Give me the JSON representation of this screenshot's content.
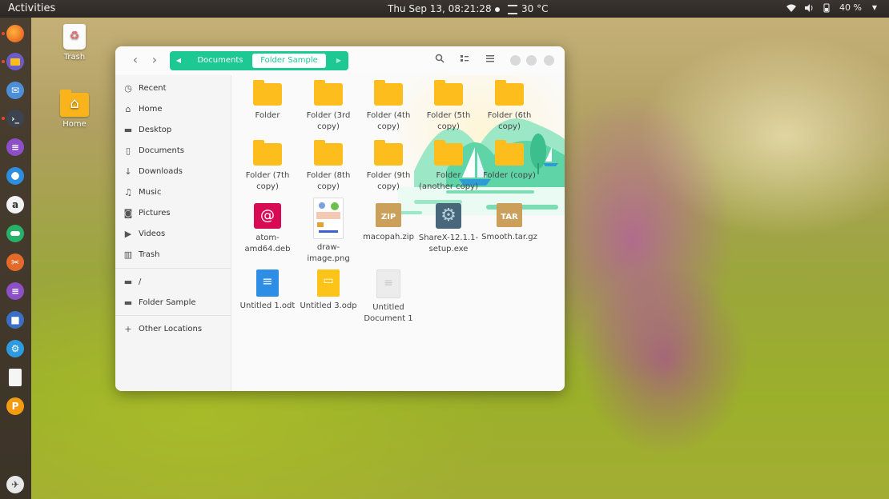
{
  "topbar": {
    "activities": "Activities",
    "clock": "Thu Sep 13, 08:21:28",
    "weather": "30 °C",
    "battery": "40 %"
  },
  "desktop": {
    "trash_label": "Trash",
    "home_label": "Home"
  },
  "dock": {
    "items": [
      "firefox-icon",
      "files-icon",
      "mail-icon",
      "terminal-icon",
      "document-icon",
      "chromium-icon",
      "amazon-icon",
      "toggle-app-icon",
      "tools-icon",
      "editor-icon",
      "workspaces-icon",
      "settings-icon",
      "text-file-icon",
      "pidgin-icon",
      "rocket-icon"
    ]
  },
  "window": {
    "pathbar": {
      "parent": "Documents",
      "current": "Folder Sample"
    },
    "sidebar": {
      "items": [
        {
          "label": "Recent",
          "icon": "clock-icon"
        },
        {
          "label": "Home",
          "icon": "home-icon"
        },
        {
          "label": "Desktop",
          "icon": "folder-icon"
        },
        {
          "label": "Documents",
          "icon": "document-icon"
        },
        {
          "label": "Downloads",
          "icon": "download-icon"
        },
        {
          "label": "Music",
          "icon": "music-icon"
        },
        {
          "label": "Pictures",
          "icon": "camera-icon"
        },
        {
          "label": "Videos",
          "icon": "video-icon"
        },
        {
          "label": "Trash",
          "icon": "trash-icon"
        }
      ],
      "devices": [
        {
          "label": "/",
          "icon": "drive-icon"
        },
        {
          "label": "Folder Sample",
          "icon": "folder-icon"
        }
      ],
      "other": {
        "label": "Other Locations",
        "icon": "plus-icon"
      }
    },
    "files": [
      {
        "name": "Folder",
        "type": "folder"
      },
      {
        "name": "Folder (3rd copy)",
        "type": "folder"
      },
      {
        "name": "Folder (4th copy)",
        "type": "folder"
      },
      {
        "name": "Folder (5th copy)",
        "type": "folder"
      },
      {
        "name": "Folder (6th copy)",
        "type": "folder"
      },
      {
        "name": "Folder (7th copy)",
        "type": "folder"
      },
      {
        "name": "Folder (8th copy)",
        "type": "folder"
      },
      {
        "name": "Folder (9th copy)",
        "type": "folder"
      },
      {
        "name": "Folder (another copy)",
        "type": "folder"
      },
      {
        "name": "Folder (copy)",
        "type": "folder"
      },
      {
        "name": "atom-amd64.deb",
        "type": "deb"
      },
      {
        "name": "draw-image.png",
        "type": "png"
      },
      {
        "name": "macopah.zip",
        "type": "zip",
        "badge": "ZIP"
      },
      {
        "name": "ShareX-12.1.1-setup.exe",
        "type": "exe"
      },
      {
        "name": "Smooth.tar.gz",
        "type": "tar",
        "badge": "TAR"
      },
      {
        "name": "Untitled 1.odt",
        "type": "odt"
      },
      {
        "name": "Untitled 3.odp",
        "type": "odp"
      },
      {
        "name": "Untitled Document 1",
        "type": "doc"
      }
    ]
  }
}
